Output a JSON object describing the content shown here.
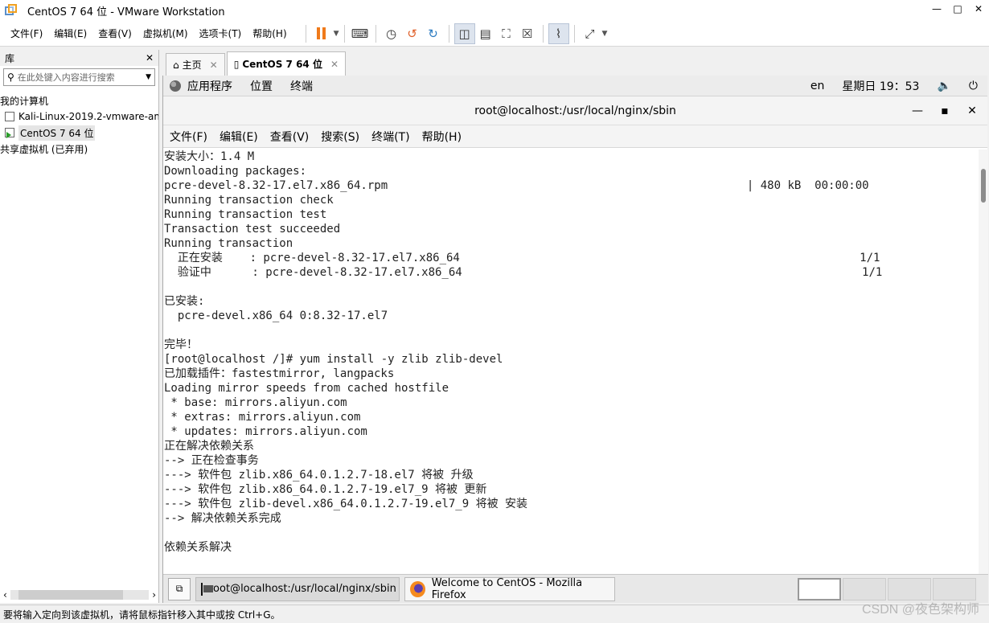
{
  "window": {
    "title": "CentOS 7 64 位 - VMware Workstation"
  },
  "menubar": {
    "items": [
      "文件(F)",
      "编辑(E)",
      "查看(V)",
      "虚拟机(M)",
      "选项卡(T)",
      "帮助(H)"
    ]
  },
  "library": {
    "title": "库",
    "search_placeholder": "在此处键入内容进行搜索",
    "tree": [
      "我的计算机",
      "Kali-Linux-2019.2-vmware-am",
      "CentOS 7 64 位",
      "共享虚拟机 (已弃用)"
    ]
  },
  "tabs": [
    {
      "label": "主页",
      "icon": "home-icon"
    },
    {
      "label": "CentOS 7 64 位",
      "icon": "vm-icon"
    }
  ],
  "guest_topbar": {
    "applications": "应用程序",
    "places": "位置",
    "terminal": "终端",
    "lang": "en",
    "clock": "星期日 19：53"
  },
  "terminal": {
    "title": "root@localhost:/usr/local/nginx/sbin",
    "menu": [
      "文件(F)",
      "编辑(E)",
      "查看(V)",
      "搜索(S)",
      "终端(T)",
      "帮助(H)"
    ],
    "lines": [
      "安装大小：1.4 M",
      "Downloading packages:",
      "pcre-devel-8.32-17.el7.x86_64.rpm                                                     | 480 kB  00:00:00",
      "Running transaction check",
      "Running transaction test",
      "Transaction test succeeded",
      "Running transaction",
      "  正在安装    : pcre-devel-8.32-17.el7.x86_64                                                           1/1",
      "  验证中      : pcre-devel-8.32-17.el7.x86_64                                                           1/1",
      "",
      "已安装:",
      "  pcre-devel.x86_64 0:8.32-17.el7",
      "",
      "完毕！",
      "[root@localhost /]# yum install -y zlib zlib-devel",
      "已加载插件：fastestmirror, langpacks",
      "Loading mirror speeds from cached hostfile",
      " * base: mirrors.aliyun.com",
      " * extras: mirrors.aliyun.com",
      " * updates: mirrors.aliyun.com",
      "正在解决依赖关系",
      "--> 正在检查事务",
      "---> 软件包 zlib.x86_64.0.1.2.7-18.el7 将被 升级",
      "---> 软件包 zlib.x86_64.0.1.2.7-19.el7_9 将被 更新",
      "---> 软件包 zlib-devel.x86_64.0.1.2.7-19.el7_9 将被 安装",
      "--> 解决依赖关系完成",
      "",
      "依赖关系解决"
    ]
  },
  "taskbar": {
    "tasks": [
      "root@localhost:/usr/local/nginx/sbin",
      "Welcome to CentOS - Mozilla Firefox"
    ]
  },
  "statusbar": {
    "text": "要将输入定向到该虚拟机，请将鼠标指针移入其中或按 Ctrl+G。"
  },
  "watermark": "CSDN @夜色架构师"
}
